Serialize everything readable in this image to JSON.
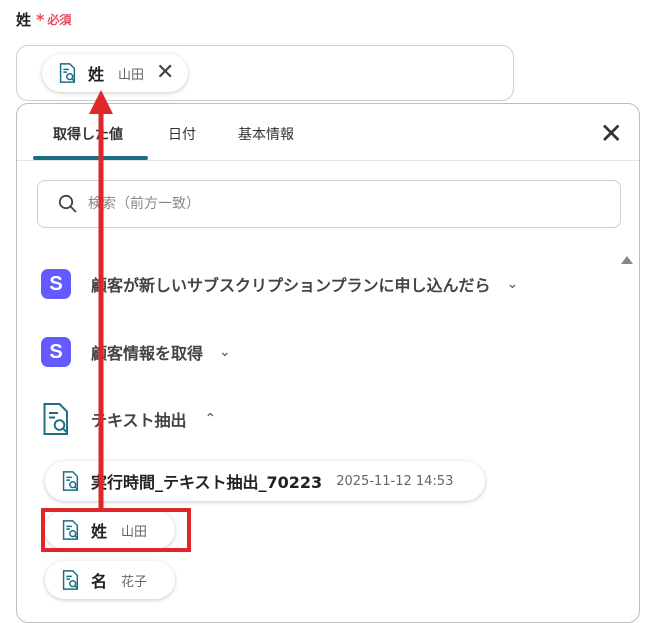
{
  "field": {
    "label": "姓",
    "required_mark": "*",
    "required_text": "必須"
  },
  "selected_chip": {
    "key": "姓",
    "value": "山田"
  },
  "tabs": [
    {
      "label": "取得した値",
      "active": true
    },
    {
      "label": "日付",
      "active": false
    },
    {
      "label": "基本情報",
      "active": false
    }
  ],
  "search": {
    "placeholder": "検索（前方一致）"
  },
  "groups": [
    {
      "icon": "stripe-s-icon",
      "icon_letter": "S",
      "title": "顧客が新しいサブスクリプションプランに申し込んだら",
      "expanded": false
    },
    {
      "icon": "stripe-s-icon",
      "icon_letter": "S",
      "title": "顧客情報を取得",
      "expanded": false
    },
    {
      "icon": "document-search-icon",
      "title": "テキスト抽出",
      "expanded": true
    }
  ],
  "items": [
    {
      "key": "実行時間_テキスト抽出_70223",
      "value": "2025-11-12 14:53"
    },
    {
      "key": "姓",
      "value": "山田",
      "highlighted": true
    },
    {
      "key": "名",
      "value": "花子"
    }
  ],
  "colors": {
    "accent": "#1b6e83",
    "required": "#e84a5f",
    "stripe": "#635bff",
    "annotation": "#e0262b"
  },
  "icons": {
    "chevron_down": "chevron-down-icon",
    "chevron_up": "chevron-up-icon",
    "close": "close-icon",
    "search": "search-icon"
  }
}
